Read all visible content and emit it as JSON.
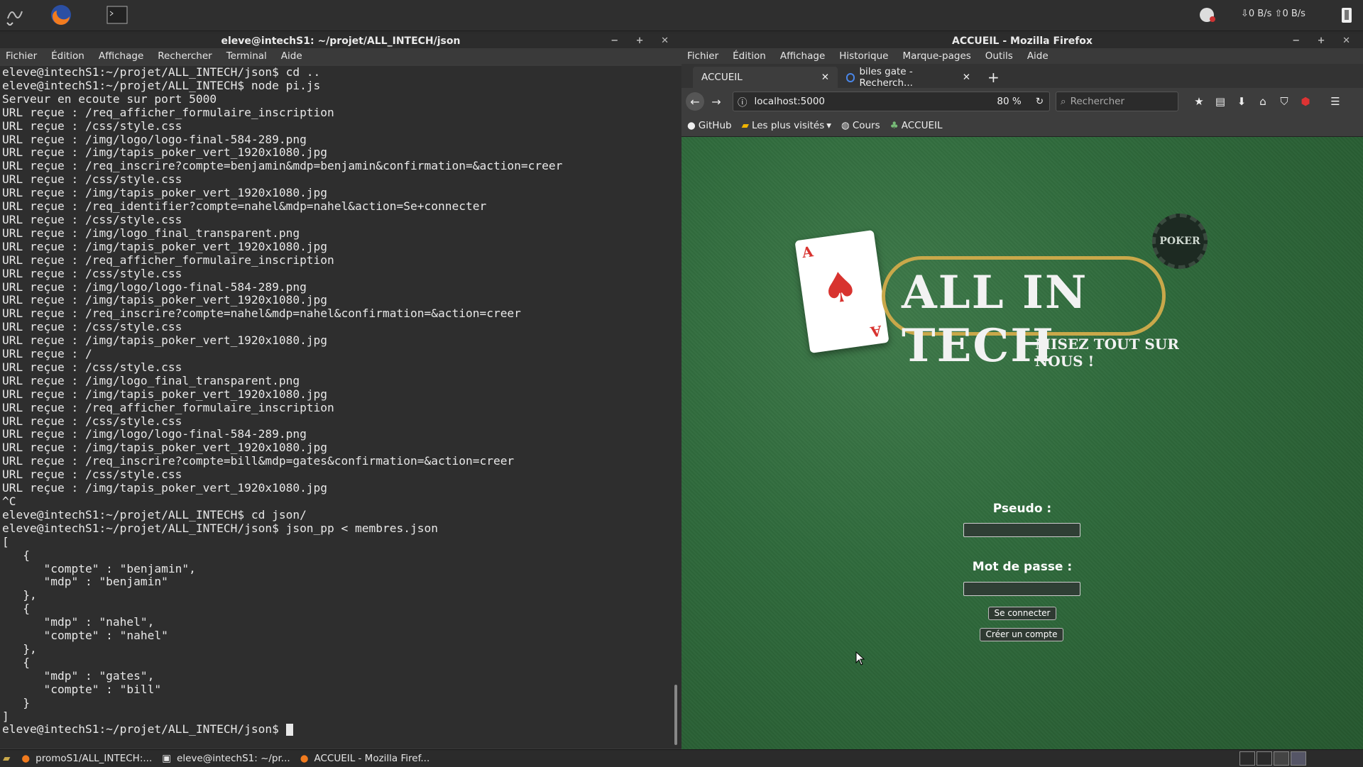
{
  "topbar": {
    "net_down": "0 B/s",
    "net_up": "0 B/s"
  },
  "terminal_window": {
    "title": "eleve@intechS1: ~/projet/ALL_INTECH/json",
    "menu": [
      "Fichier",
      "Édition",
      "Affichage",
      "Rechercher",
      "Terminal",
      "Aide"
    ],
    "lines": [
      "eleve@intechS1:~/projet/ALL_INTECH/json$ cd ..",
      "eleve@intechS1:~/projet/ALL_INTECH$ node pi.js",
      "Serveur en ecoute sur port 5000",
      "URL reçue : /req_afficher_formulaire_inscription",
      "URL reçue : /css/style.css",
      "URL reçue : /img/logo/logo-final-584-289.png",
      "URL reçue : /img/tapis_poker_vert_1920x1080.jpg",
      "URL reçue : /req_inscrire?compte=benjamin&mdp=benjamin&confirmation=&action=creer",
      "URL reçue : /css/style.css",
      "URL reçue : /img/tapis_poker_vert_1920x1080.jpg",
      "URL reçue : /req_identifier?compte=nahel&mdp=nahel&action=Se+connecter",
      "URL reçue : /css/style.css",
      "URL reçue : /img/logo_final_transparent.png",
      "URL reçue : /img/tapis_poker_vert_1920x1080.jpg",
      "URL reçue : /req_afficher_formulaire_inscription",
      "URL reçue : /css/style.css",
      "URL reçue : /img/logo/logo-final-584-289.png",
      "URL reçue : /img/tapis_poker_vert_1920x1080.jpg",
      "URL reçue : /req_inscrire?compte=nahel&mdp=nahel&confirmation=&action=creer",
      "URL reçue : /css/style.css",
      "URL reçue : /img/tapis_poker_vert_1920x1080.jpg",
      "URL reçue : /",
      "URL reçue : /css/style.css",
      "URL reçue : /img/logo_final_transparent.png",
      "URL reçue : /img/tapis_poker_vert_1920x1080.jpg",
      "URL reçue : /req_afficher_formulaire_inscription",
      "URL reçue : /css/style.css",
      "URL reçue : /img/logo/logo-final-584-289.png",
      "URL reçue : /img/tapis_poker_vert_1920x1080.jpg",
      "URL reçue : /req_inscrire?compte=bill&mdp=gates&confirmation=&action=creer",
      "URL reçue : /css/style.css",
      "URL reçue : /img/tapis_poker_vert_1920x1080.jpg",
      "^C",
      "eleve@intechS1:~/projet/ALL_INTECH$ cd json/",
      "eleve@intechS1:~/projet/ALL_INTECH/json$ json_pp < membres.json",
      "[",
      "   {",
      "      \"compte\" : \"benjamin\",",
      "      \"mdp\" : \"benjamin\"",
      "   },",
      "   {",
      "      \"mdp\" : \"nahel\",",
      "      \"compte\" : \"nahel\"",
      "   },",
      "   {",
      "      \"mdp\" : \"gates\",",
      "      \"compte\" : \"bill\"",
      "   }",
      "]"
    ],
    "prompt": "eleve@intechS1:~/projet/ALL_INTECH/json$ "
  },
  "firefox_window": {
    "title": "ACCUEIL - Mozilla Firefox",
    "menu": [
      "Fichier",
      "Édition",
      "Affichage",
      "Historique",
      "Marque-pages",
      "Outils",
      "Aide"
    ],
    "tabs": [
      {
        "label": "ACCUEIL"
      },
      {
        "label": "biles gate - Recherch..."
      }
    ],
    "url": "localhost:5000",
    "zoom": "80 %",
    "search_placeholder": "Rechercher",
    "bookmarks": [
      "GitHub",
      "Les plus visités",
      "Cours",
      "ACCUEIL"
    ]
  },
  "page": {
    "logo_text": "ALL IN TECH",
    "logo_chip_text": "POKER",
    "card_rank": "A",
    "slogan": "MISEZ TOUT SUR NOUS !",
    "pseudo_label": "Pseudo :",
    "password_label": "Mot de passe :",
    "login_button": "Se connecter",
    "create_button": "Créer un compte"
  },
  "taskbar": {
    "items": [
      "promoS1/ALL_INTECH:...",
      "eleve@intechS1: ~/pr...",
      "ACCUEIL - Mozilla Firef..."
    ]
  },
  "colors": {
    "felt_green": "#2f6a3c",
    "logo_gold": "#c9a84a",
    "card_red": "#d8332f"
  }
}
